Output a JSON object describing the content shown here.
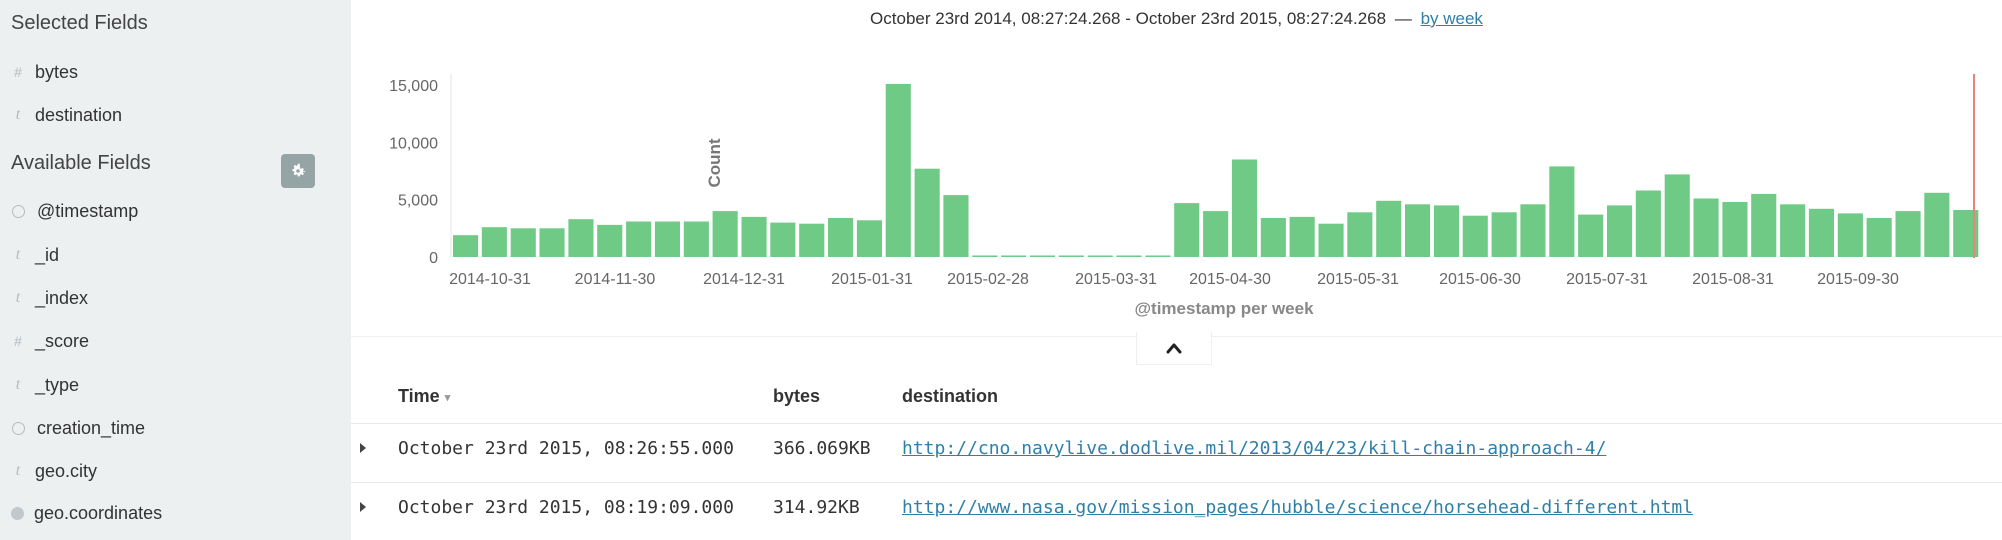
{
  "sidebar": {
    "selected_title": "Selected Fields",
    "selected_fields": [
      {
        "name": "bytes",
        "type": "#"
      },
      {
        "name": "destination",
        "type": "t"
      }
    ],
    "available_title": "Available Fields",
    "available_fields": [
      {
        "name": "@timestamp",
        "type": "clock"
      },
      {
        "name": "_id",
        "type": "t"
      },
      {
        "name": "_index",
        "type": "t"
      },
      {
        "name": "_score",
        "type": "#"
      },
      {
        "name": "_type",
        "type": "t"
      },
      {
        "name": "creation_time",
        "type": "clock"
      },
      {
        "name": "geo.city",
        "type": "t"
      },
      {
        "name": "geo.coordinates",
        "type": "globe"
      }
    ],
    "settings_icon": "gear-icon"
  },
  "header": {
    "range_text": "October 23rd 2014, 08:27:24.268 - October 23rd 2015, 08:27:24.268",
    "separator": "—",
    "interval_link": "by week"
  },
  "chart_data": {
    "type": "bar",
    "ylabel": "Count",
    "xlabel": "@timestamp per week",
    "ylim": [
      0,
      15000
    ],
    "y_ticks": [
      "15,000",
      "10,000",
      "5,000",
      "0"
    ],
    "x_ticks": [
      "2014-10-31",
      "2014-11-30",
      "2014-12-31",
      "2015-01-31",
      "2015-02-28",
      "2015-03-31",
      "2015-04-30",
      "2015-05-31",
      "2015-06-30",
      "2015-07-31",
      "2015-08-31",
      "2015-09-30"
    ],
    "bar_color": "#6eca84",
    "grid": false,
    "values": [
      1900,
      2600,
      2500,
      2500,
      3300,
      2800,
      3100,
      3100,
      3100,
      4000,
      3500,
      3000,
      2900,
      3400,
      3200,
      15100,
      7700,
      5400,
      100,
      60,
      120,
      60,
      60,
      60,
      100,
      4700,
      4000,
      8500,
      3400,
      3500,
      2900,
      3900,
      4900,
      4600,
      4500,
      3600,
      3900,
      4600,
      7900,
      3700,
      4500,
      5800,
      7200,
      5100,
      4800,
      5500,
      4600,
      4200,
      3800,
      3400,
      4000,
      5600,
      4100
    ]
  },
  "table": {
    "columns": [
      "Time",
      "bytes",
      "destination"
    ],
    "sort_caret": "▾",
    "rows": [
      {
        "time": "October 23rd 2015, 08:26:55.000",
        "bytes": "366.069KB",
        "destination": "http://cno.navylive.dodlive.mil/2013/04/23/kill-chain-approach-4/"
      },
      {
        "time": "October 23rd 2015, 08:19:09.000",
        "bytes": "314.92KB",
        "destination": "http://www.nasa.gov/mission_pages/hubble/science/horsehead-different.html"
      }
    ]
  },
  "collapse_icon": "chevron-up-icon"
}
